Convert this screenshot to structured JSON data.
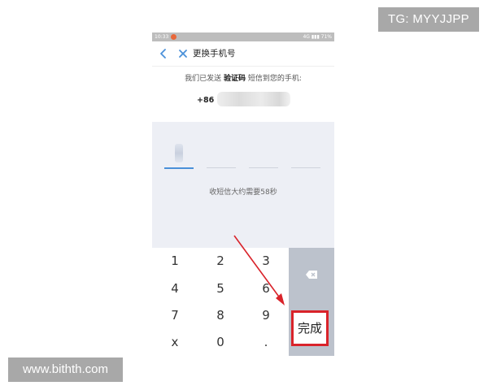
{
  "watermarks": {
    "top": "TG: MYYJJPP",
    "bottom": "www.bithth.com"
  },
  "status_bar": {
    "time": "10:33",
    "right": "4G ▮▮▮ 71%"
  },
  "nav": {
    "title": "更换手机号",
    "back_icon": "chevron-left-icon",
    "close_icon": "close-icon"
  },
  "message": {
    "prefix": "我们已发送",
    "highlight": "验证码",
    "suffix": "短信到您的手机:",
    "phone_prefix": "+86"
  },
  "countdown": "收短信大约需要58秒",
  "keypad": {
    "keys": [
      "1",
      "2",
      "3",
      "4",
      "5",
      "6",
      "7",
      "8",
      "9",
      "x",
      "0",
      "."
    ],
    "done_label": "完成",
    "delete_icon": "backspace-icon"
  },
  "colors": {
    "accent": "#4a90d9",
    "highlight_box": "#d9232a",
    "arrow": "#d9232a",
    "key_side": "#bcc2cc",
    "code_bg": "#edeff5"
  }
}
